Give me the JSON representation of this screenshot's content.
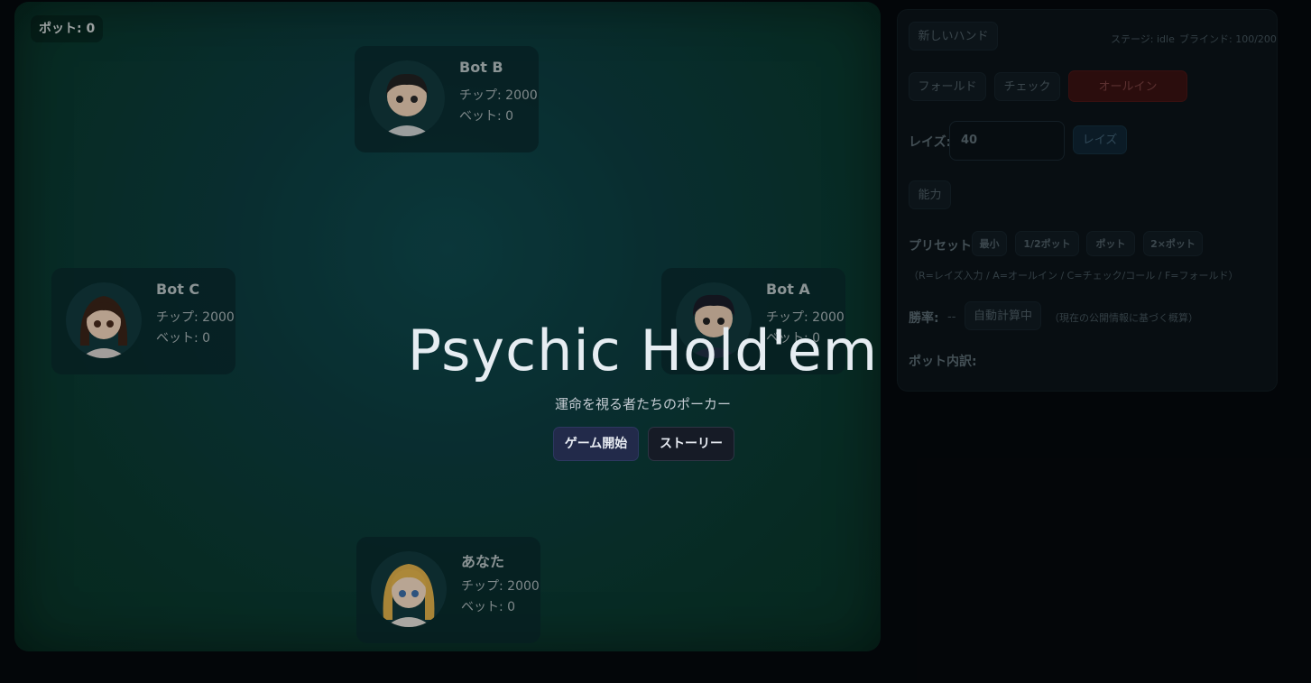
{
  "table": {
    "pot_label": "ポット: 0"
  },
  "seats": [
    {
      "name": "Bot B",
      "chips": "チップ: 2000",
      "bet": "ベット: 0"
    },
    {
      "name": "Bot C",
      "chips": "チップ: 2000",
      "bet": "ベット: 0"
    },
    {
      "name": "Bot A",
      "chips": "チップ: 2000",
      "bet": "ベット: 0"
    },
    {
      "name": "あなた",
      "chips": "チップ: 2000",
      "bet": "ベット: 0"
    }
  ],
  "panel": {
    "new_hand": "新しいハンド",
    "stage": "ステージ: idle",
    "blinds": "ブラインド: 100/200",
    "fold": "フォールド",
    "check": "チェック",
    "allin": "オールイン",
    "raise_label": "レイズ:",
    "raise_value": "40",
    "raise_button": "レイズ",
    "ability": "能力",
    "preset_label": "プリセット:",
    "presets": [
      "最小",
      "1/2ポット",
      "ポット",
      "2×ポット"
    ],
    "hotkeys": "（R=レイズ入力 / A=オールイン / C=チェック/コール / F=フォールド）",
    "winrate_label": "勝率:",
    "winrate_value": "--",
    "auto_calc": "自動計算中",
    "winrate_note": "（現在の公開情報に基づく概算）",
    "pot_breakdown": "ポット内訳:"
  },
  "overlay": {
    "title": "Psychic Hold'em",
    "subtitle": "運命を視る者たちのポーカー",
    "start": "ゲーム開始",
    "story": "ストーリー"
  },
  "colors": {
    "table_felt": "#0c3d40",
    "allin_red": "#3a1212",
    "start_button": "#222a4a"
  }
}
